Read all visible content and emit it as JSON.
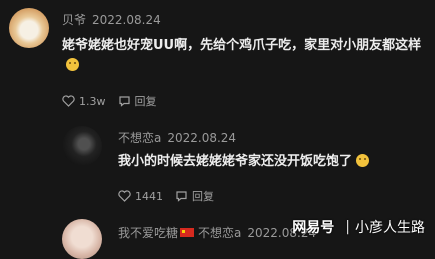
{
  "comments": [
    {
      "username": "贝爷",
      "date": "2022.08.24",
      "text": "姥爷姥姥也好宠UU啊，先给个鸡爪子吃，家里对小朋友都这样",
      "likes": "1.3w",
      "reply_label": "回复"
    },
    {
      "username": "不想恋a",
      "date": "2022.08.24",
      "text": "我小的时候去姥姥姥爷家还没开饭吃饱了",
      "likes": "1441",
      "reply_label": "回复"
    },
    {
      "username": "我不爱吃糖",
      "extra_user": "不想恋a",
      "date": "2022.08.24"
    }
  ],
  "watermark": {
    "brand": "网易号",
    "channel": "小彦人生路"
  }
}
